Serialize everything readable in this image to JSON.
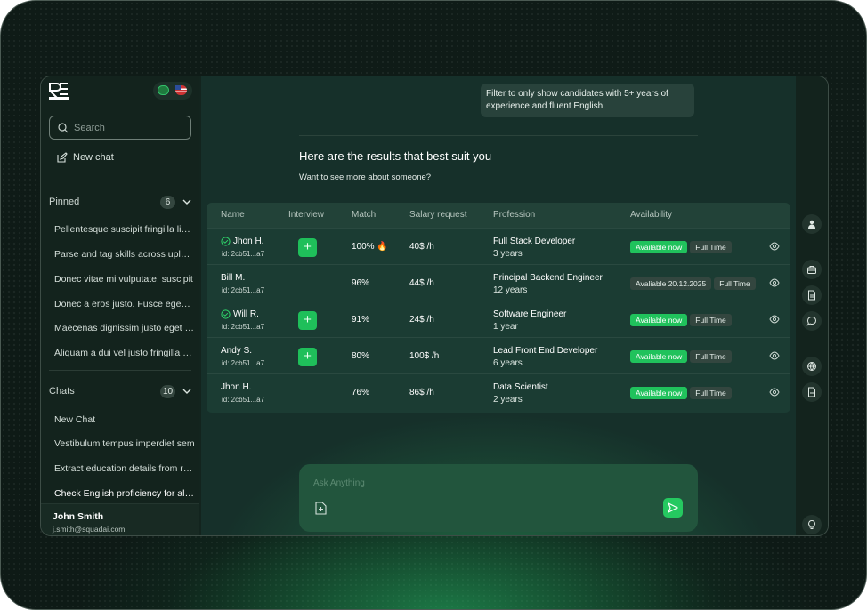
{
  "sidebar": {
    "search_placeholder": "Search",
    "new_chat": "New chat",
    "pinned": {
      "title": "Pinned",
      "count": "6",
      "items": [
        "Pellentesque suscipit fringilla libero",
        "Parse and tag skills across uploaded CVs",
        "Donec vitae mi vulputate, suscipit",
        "Donec a eros justo. Fusce egestas",
        "Maecenas dignissim justo eget nulla",
        "Aliquam a dui vel justo fringilla euismod"
      ]
    },
    "chats": {
      "title": "Chats",
      "count": "10",
      "items": [
        "New Chat",
        "Vestibulum tempus imperdiet sem",
        "Extract education details from resumes",
        "Check English proficiency for all candidates"
      ]
    },
    "user": {
      "name": "John Smith",
      "email": "j.smith@squadai.com"
    }
  },
  "chat": {
    "user_message": "Filter to only show candidates with 5+ years of experience and fluent English.",
    "results_title": "Here are the results that best suit you",
    "results_subtitle": "Want to see more about someone?",
    "input_placeholder": "Ask Anything"
  },
  "table": {
    "headers": [
      "Name",
      "Interview",
      "Match",
      "Salary request",
      "Profession",
      "Availability"
    ],
    "rows": [
      {
        "name": "Jhon H.",
        "id": "id: 2cb51...a7",
        "verified": true,
        "interview": "+",
        "match": "100% 🔥",
        "salary": "40$ /h",
        "profession": "Full Stack Developer",
        "years": "3 years",
        "availability": "Available now",
        "type": "Full Time"
      },
      {
        "name": "Bill M.",
        "id": "id: 2cb51...a7",
        "verified": false,
        "interview": "",
        "match": "96%",
        "salary": "44$ /h",
        "profession": "Principal Backend Engineer",
        "years": "12 years",
        "availability": "Avaliable 20.12.2025",
        "type": "Full Time"
      },
      {
        "name": "Will R.",
        "id": "id: 2cb51...a7",
        "verified": true,
        "interview": "+",
        "match": "91%",
        "salary": "24$ /h",
        "profession": "Software Engineer",
        "years": "1 year",
        "availability": "Available now",
        "type": "Full Time"
      },
      {
        "name": "Andy S.",
        "id": "id: 2cb51...a7",
        "verified": false,
        "interview": "+",
        "match": "80%",
        "salary": "100$ /h",
        "profession": "Lead Front End Developer",
        "years": "6 years",
        "availability": "Available now",
        "type": "Full Time"
      },
      {
        "name": "Jhon H.",
        "id": "id: 2cb51...a7",
        "verified": false,
        "interview": "",
        "match": "76%",
        "salary": "86$ /h",
        "profession": "Data Scientist",
        "years": "2 years",
        "availability": "Available now",
        "type": "Full Time"
      }
    ]
  },
  "colors": {
    "accent": "#20c25c",
    "background": "#13241e",
    "panel": "#1b3c33"
  },
  "icons": [
    "search-icon",
    "edit-icon",
    "chevron-down-icon",
    "check-circle-icon",
    "eye-icon",
    "user-icon",
    "briefcase-icon",
    "document-icon",
    "chat-bubble-icon",
    "globe-icon",
    "file-icon",
    "lightbulb-icon",
    "attach-file-icon",
    "send-icon"
  ]
}
